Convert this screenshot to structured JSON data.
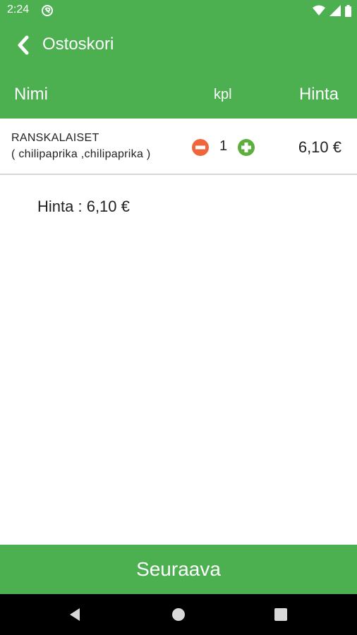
{
  "status_bar": {
    "time": "2:24",
    "icons": [
      "app-notification-icon",
      "wifi-icon",
      "signal-icon",
      "battery-icon"
    ]
  },
  "app_bar": {
    "title": "Ostoskori",
    "back_icon": "chevron-left-icon"
  },
  "table_header": {
    "name": "Nimi",
    "quantity": "kpl",
    "price": "Hinta"
  },
  "cart_items": [
    {
      "name": "RANSKALAISET",
      "options": "( chilipaprika ,chilipaprika )",
      "quantity": "1",
      "price": "6,10 €"
    }
  ],
  "total": {
    "label": "Hinta : ",
    "value": "6,10 €"
  },
  "next_button": {
    "label": "Seuraava"
  },
  "colors": {
    "primary": "#4caf50",
    "minus": "#f0653c",
    "plus": "#5dae3c"
  },
  "nav_bar": {
    "icons": [
      "back-icon",
      "home-icon",
      "recents-icon"
    ]
  }
}
